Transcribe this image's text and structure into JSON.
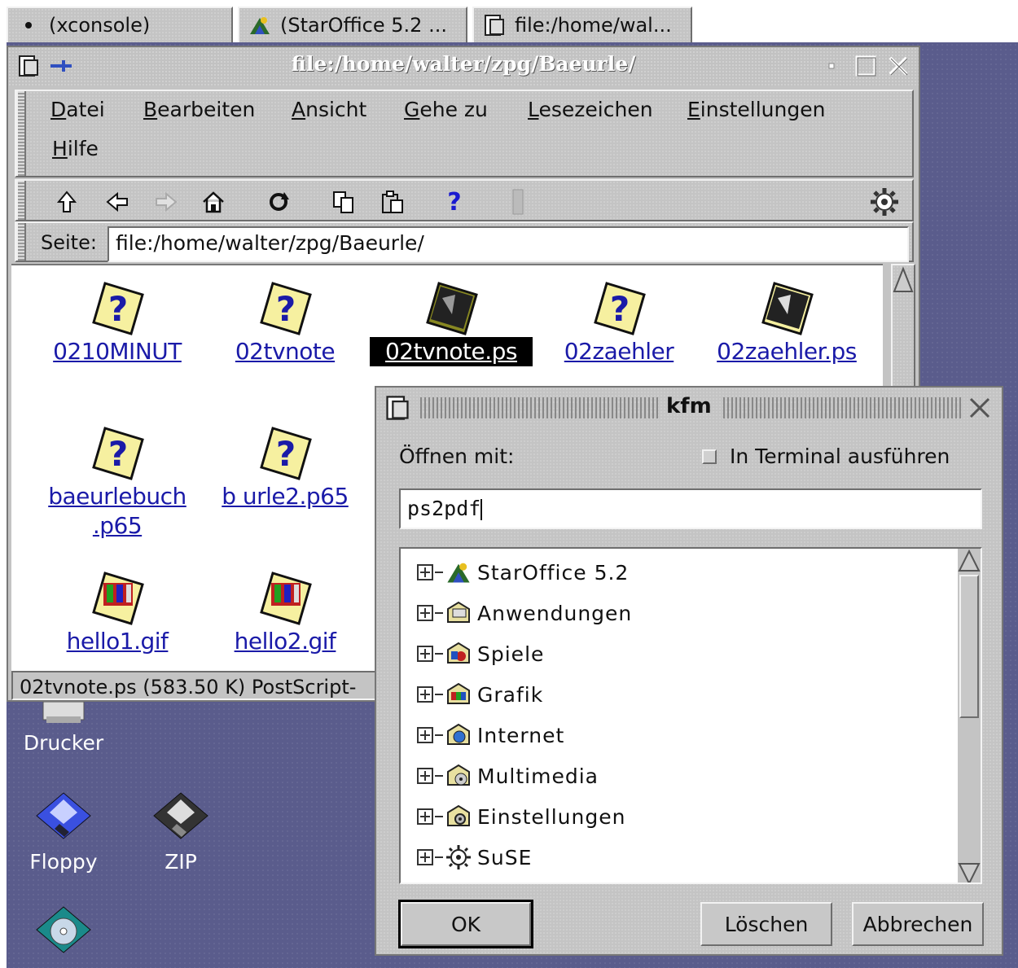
{
  "taskbar": {
    "tasks": [
      {
        "label": "(xconsole)",
        "icon": "dot-icon"
      },
      {
        "label": "(StarOffice 5.2 ...",
        "icon": "staroffice-icon"
      },
      {
        "label": "file:/home/wal...",
        "icon": "kfm-icon"
      }
    ]
  },
  "main_window": {
    "title": "file:/home/walter/zpg/Baeurle/",
    "menu": [
      {
        "label_u": "D",
        "label_rest": "atei"
      },
      {
        "label_u": "B",
        "label_rest": "earbeiten"
      },
      {
        "label_u": "A",
        "label_rest": "nsicht"
      },
      {
        "label_u": "G",
        "label_rest": "ehe zu"
      },
      {
        "label_u": "L",
        "label_rest": "esezeichen"
      },
      {
        "label_u": "E",
        "label_rest": "instellungen"
      },
      {
        "label_u": "H",
        "label_rest": "ilfe"
      }
    ],
    "toolbar_icons": [
      "up-arrow-icon",
      "back-arrow-icon",
      "forward-arrow-icon",
      "home-icon",
      "reload-icon",
      "copy-icon",
      "paste-icon",
      "help-icon",
      "stop-icon",
      "kde-gear-icon"
    ],
    "location": {
      "label": "Seite:",
      "value": "file:/home/walter/zpg/Baeurle/"
    },
    "files": [
      {
        "name": "0210MINUT",
        "icon": "unknown-file-icon",
        "selected": false
      },
      {
        "name": "02tvnote",
        "icon": "unknown-file-icon",
        "selected": false
      },
      {
        "name": "02tvnote.ps",
        "icon": "postscript-file-icon",
        "selected": true
      },
      {
        "name": "02zaehler",
        "icon": "unknown-file-icon",
        "selected": false
      },
      {
        "name": "02zaehler.ps",
        "icon": "postscript-file-icon",
        "selected": false
      },
      {
        "name": "baeurlebuch",
        "name2": ".p65",
        "icon": "unknown-file-icon",
        "selected": false
      },
      {
        "name": "b urle2.p65",
        "icon": "unknown-file-icon",
        "selected": false
      },
      {
        "name": "hello1.gif",
        "icon": "image-file-icon",
        "selected": false
      },
      {
        "name": "hello2.gif",
        "icon": "image-file-icon",
        "selected": false
      }
    ],
    "status": "02tvnote.ps (583.50 K)  PostScript-"
  },
  "desktop_icons": [
    {
      "label": "Drucker",
      "icon": "printer-icon"
    },
    {
      "label": "Floppy",
      "icon": "floppy-icon"
    },
    {
      "label": "ZIP",
      "icon": "zip-disk-icon"
    }
  ],
  "dialog": {
    "title": "kfm",
    "open_with_label": "Öffnen mit:",
    "terminal_label": "In Terminal ausführen",
    "terminal_checked": false,
    "command_value": "ps2pdf",
    "tree": [
      {
        "label": "StarOffice 5.2",
        "icon": "staroffice-icon"
      },
      {
        "label": "Anwendungen",
        "icon": "applications-folder-icon"
      },
      {
        "label": "Spiele",
        "icon": "games-folder-icon"
      },
      {
        "label": "Grafik",
        "icon": "graphics-folder-icon"
      },
      {
        "label": "Internet",
        "icon": "internet-folder-icon"
      },
      {
        "label": "Multimedia",
        "icon": "multimedia-folder-icon"
      },
      {
        "label": "Einstellungen",
        "icon": "settings-folder-icon"
      },
      {
        "label": "SuSE",
        "icon": "suse-gear-icon"
      }
    ],
    "buttons": {
      "ok": "OK",
      "clear": "Löschen",
      "cancel": "Abbrechen"
    }
  },
  "colors": {
    "desktop": "#5a5c8c",
    "link": "#1a1aa8",
    "window_gray": "#c4c4c4"
  }
}
